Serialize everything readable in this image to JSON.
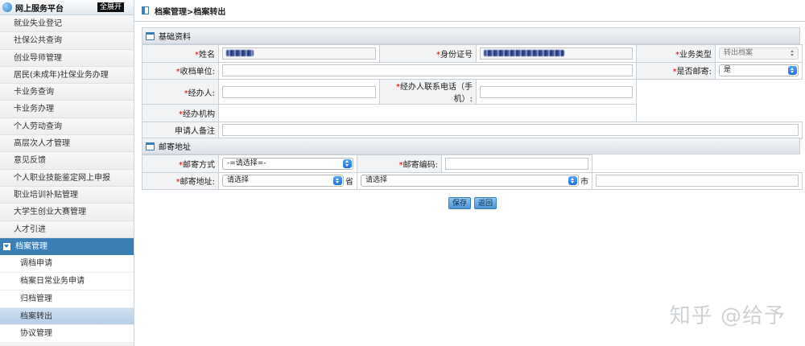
{
  "sidebar": {
    "title": "网上服务平台",
    "expand_all": "全展开",
    "items": [
      "就业失业登记",
      "社保公共查询",
      "创业导师管理",
      "居民(未成年)社保业务办理",
      "卡业务查询",
      "卡业务办理",
      "个人劳动查询",
      "高层次人才管理",
      "意见反馈",
      "个人职业技能鉴定网上申报",
      "职业培训补贴管理",
      "大学生创业大赛管理",
      "人才引进"
    ],
    "group": "档案管理",
    "sub_items": [
      "调档申请",
      "档案日常业务申请",
      "归档管理",
      "档案转出",
      "协议管理"
    ]
  },
  "breadcrumb": "档案管理>档案转出",
  "basic_section": {
    "title": "基础资料",
    "name_label": "姓名",
    "id_label": "身份证号",
    "biz_type_label": "业务类型",
    "biz_type_value": "转出档案",
    "receiver_label": "收档单位:",
    "mail_label": "是否邮寄:",
    "mail_value": "是",
    "handler_label": "经办人:",
    "handler_phone_label": "经办人联系电话（手机）:",
    "agency_label": "经办机构",
    "remark_label": "申请人备注"
  },
  "mail_section": {
    "title": "邮寄地址",
    "method_label": "邮寄方式",
    "method_value": "-=请选择=-",
    "postcode_label": "邮寄编码:",
    "address_label": "邮寄地址:",
    "province_value": "请选择",
    "province_suffix": "省",
    "city_value": "请选择",
    "city_suffix": "市"
  },
  "buttons": {
    "save": "保存",
    "back": "返回"
  },
  "watermark": "知乎 @给予",
  "colors": {
    "accent": "#3b7fb6",
    "required": "#dd0000",
    "header_bg": "#dde2e8"
  }
}
